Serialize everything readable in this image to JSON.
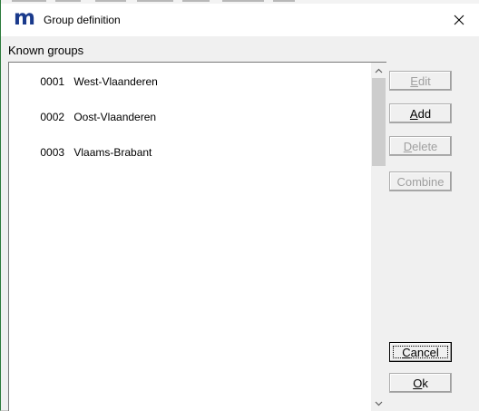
{
  "window": {
    "app_icon": "m",
    "title": "Group definition",
    "close_icon": "close-icon"
  },
  "known_groups": {
    "label": "Known groups",
    "items": [
      {
        "code": "0001",
        "name": "West-Vlaanderen"
      },
      {
        "code": "0002",
        "name": "Oost-Vlaanderen"
      },
      {
        "code": "0003",
        "name": "Vlaams-Brabant"
      }
    ]
  },
  "buttons": {
    "edit": {
      "label_accel": "E",
      "label_rest": "dit",
      "enabled": false
    },
    "add": {
      "label_accel": "A",
      "label_rest": "dd",
      "enabled": true
    },
    "delete": {
      "label_accel": "D",
      "label_rest": "elete",
      "enabled": false
    },
    "combine": {
      "label": "Combine",
      "enabled": false
    },
    "cancel": {
      "label_accel": "C",
      "label_rest": "ancel",
      "enabled": true
    },
    "ok": {
      "label_accel": "O",
      "label_rest": "k",
      "enabled": true
    }
  },
  "colors": {
    "title_icon": "#1a3a8c",
    "window_bg": "#f0f0f0",
    "disabled_text": "#a0a0a0"
  }
}
